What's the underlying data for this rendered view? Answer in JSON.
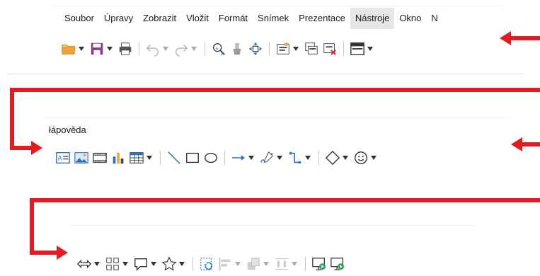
{
  "menubar": {
    "items": [
      "Soubor",
      "Úpravy",
      "Zobrazit",
      "Vložit",
      "Formát",
      "Snímek",
      "Prezentace",
      "Nástroje",
      "Okno",
      "N"
    ],
    "active_index": 7
  },
  "menubar_continued": {
    "label": "łápověda"
  },
  "toolbar1": {
    "icons": [
      "open-folder",
      "save",
      "print",
      "undo",
      "redo",
      "find-replace",
      "clone-formatting",
      "pan-zoom",
      "new-slide",
      "duplicate-slide",
      "delete-slide",
      "display-views"
    ]
  },
  "toolbar2": {
    "icons": [
      "text-box",
      "image",
      "media",
      "chart",
      "table",
      "line",
      "rectangle",
      "ellipse",
      "line-arrow",
      "curve",
      "connector",
      "basic-shapes",
      "symbol-shapes"
    ]
  },
  "toolbar3": {
    "icons": [
      "block-arrows",
      "flowchart",
      "callouts",
      "stars",
      "transformations",
      "align",
      "arrange",
      "distribute",
      "start-first-slide",
      "start-current-slide"
    ]
  },
  "colors": {
    "arrow": "#e31b23",
    "accent_blue": "#2b72c7",
    "save_purple": "#8e3a8e",
    "folder_orange": "#f0a23a"
  }
}
